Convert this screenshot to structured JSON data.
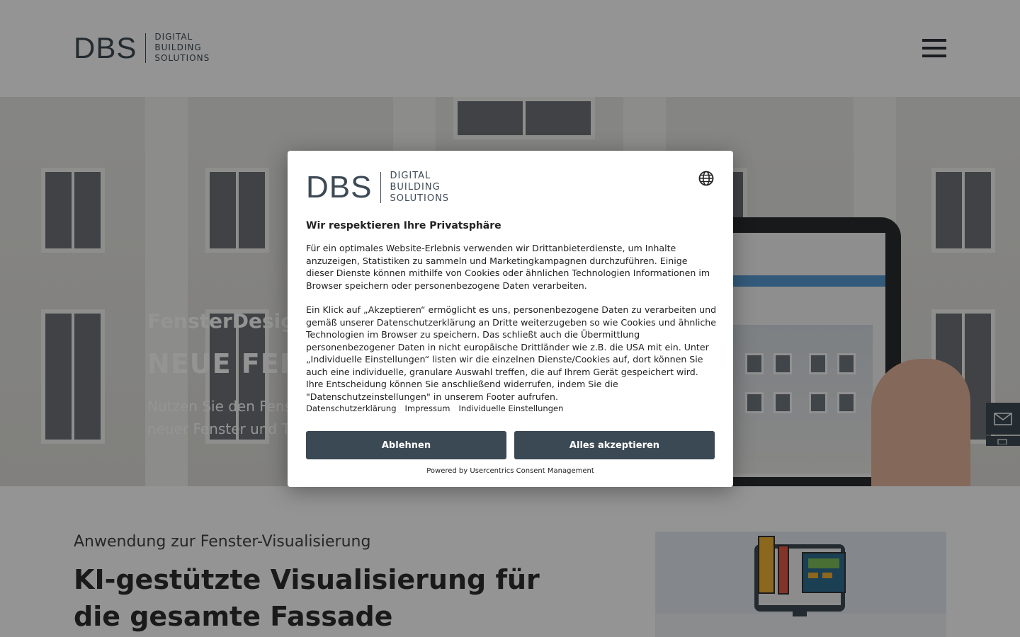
{
  "header": {
    "logo_mark": "DBS",
    "logo_words": [
      "DIGITAL",
      "BUILDING",
      "SOLUTIONS"
    ]
  },
  "hero": {
    "subtitle": "FensterDesign",
    "title": "NEUE FENS",
    "paragraph_line1": "Nutzen Sie den Fens",
    "paragraph_line2": "neuer Fenster und T"
  },
  "content": {
    "kicker": "Anwendung zur Fenster-Visualisierung",
    "heading": "KI-gestützte Visualisierung für die gesamte Fassade"
  },
  "modal": {
    "logo_mark": "DBS",
    "logo_words": [
      "DIGITAL",
      "BUILDING",
      "SOLUTIONS"
    ],
    "title": "Wir respektieren Ihre Privatsphäre",
    "paragraph1": "Für ein optimales Website-Erlebnis verwenden wir Drittanbieterdienste, um Inhalte anzuzeigen, Statistiken zu sammeln und Marketingkampagnen durchzuführen. Einige dieser Dienste können mithilfe von Cookies oder ähnlichen Technologien Informationen im Browser speichern oder personenbezogene Daten verarbeiten.",
    "paragraph2": "Ein Klick auf „Akzeptieren“ ermöglicht es uns, personenbezogene Daten zu verarbeiten und gemäß unserer Datenschutzerklärung an Dritte weiterzugeben so wie Cookies und ähnliche Technologien im Browser zu speichern. Das schließt auch die Übermittlung personenbezogener Daten in nicht europäische Drittländer wie z.B. die USA mit ein. Unter „Individuelle Einstellungen“ listen wir die einzelnen Dienste/Cookies auf, dort können Sie auch eine individuelle, granulare Auswahl treffen, die auf Ihrem Gerät gespeichert wird. Ihre Entscheidung können Sie anschließend widerrufen, indem Sie die \"Datenschutzeinstellungen\" in unserem Footer aufrufen.",
    "links": {
      "privacy": "Datenschutzerklärung",
      "imprint": "Impressum",
      "settings": "Individuelle Einstellungen"
    },
    "decline_label": "Ablehnen",
    "accept_label": "Alles akzeptieren",
    "powered_by": "Powered by Usercentrics Consent Management"
  },
  "icons": {
    "globe": "globe-icon",
    "mail": "mail-icon",
    "menu": "hamburger-menu-icon"
  },
  "colors": {
    "primary": "#3b4954",
    "logo": "#3d4a55",
    "overlay": "rgba(0,0,0,0.42)"
  }
}
